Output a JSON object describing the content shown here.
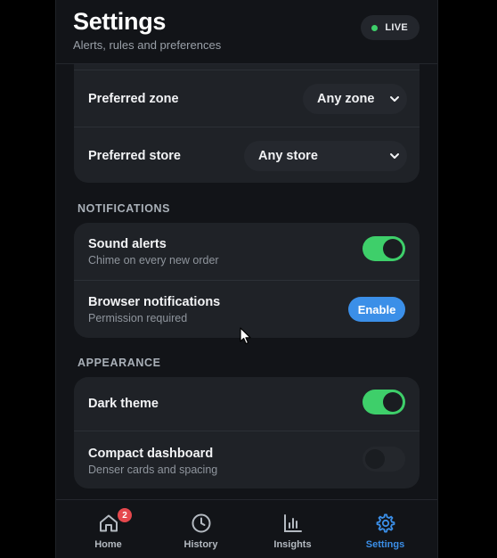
{
  "header": {
    "title": "Settings",
    "subtitle": "Alerts, rules and preferences",
    "live_label": "LIVE",
    "live_color": "#3ecf6a"
  },
  "preferences": {
    "zone_label": "Preferred zone",
    "zone_value": "Any zone",
    "store_label": "Preferred store",
    "store_value": "Any store"
  },
  "notifications": {
    "section_title": "NOTIFICATIONS",
    "sound_label": "Sound alerts",
    "sound_sub": "Chime on every new order",
    "sound_on": true,
    "browser_label": "Browser notifications",
    "browser_sub": "Permission required",
    "enable_label": "Enable"
  },
  "appearance": {
    "section_title": "APPEARANCE",
    "dark_label": "Dark theme",
    "dark_on": true,
    "compact_label": "Compact dashboard",
    "compact_sub": "Denser cards and spacing",
    "compact_on": false
  },
  "tabs": [
    {
      "label": "Home",
      "icon": "home-icon",
      "badge": "2",
      "active": false
    },
    {
      "label": "History",
      "icon": "clock-icon",
      "active": false
    },
    {
      "label": "Insights",
      "icon": "bar-chart-icon",
      "active": false
    },
    {
      "label": "Settings",
      "icon": "gear-icon",
      "active": true
    }
  ],
  "colors": {
    "accent": "#3b8fe8",
    "toggle_on": "#3ecf6a",
    "badge": "#e5484d",
    "background": "#121418",
    "card": "#1f2227"
  }
}
